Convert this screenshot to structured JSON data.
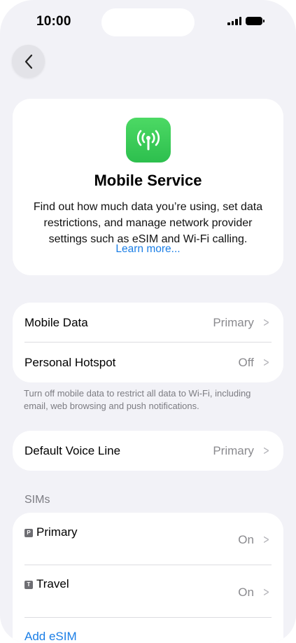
{
  "status_bar": {
    "time": "10:00"
  },
  "hero": {
    "title": "Mobile Service",
    "description": "Find out how much data you’re using, set data restrictions, and manage network provider settings such as eSIM and Wi-Fi calling.",
    "link": "Learn more..."
  },
  "data_group": {
    "rows": [
      {
        "label": "Mobile Data",
        "value": "Primary"
      },
      {
        "label": "Personal Hotspot",
        "value": "Off"
      }
    ],
    "footnote": "Turn off mobile data to restrict all data to Wi-Fi, including email, web browsing and push notifications."
  },
  "voice_group": {
    "rows": [
      {
        "label": "Default Voice Line",
        "value": "Primary"
      }
    ]
  },
  "sims": {
    "header": "SIMs",
    "items": [
      {
        "badge": "P",
        "name": "Primary",
        "value": "On"
      },
      {
        "badge": "T",
        "name": "Travel",
        "value": "On"
      }
    ],
    "add_label": "Add eSIM"
  },
  "colors": {
    "accent": "#1a7ee6",
    "icon_green": "#34c759",
    "background": "#f2f2f7"
  },
  "icons": {
    "back": "chevron-left-icon",
    "app": "antenna-icon",
    "row": "chevron-right-icon"
  }
}
